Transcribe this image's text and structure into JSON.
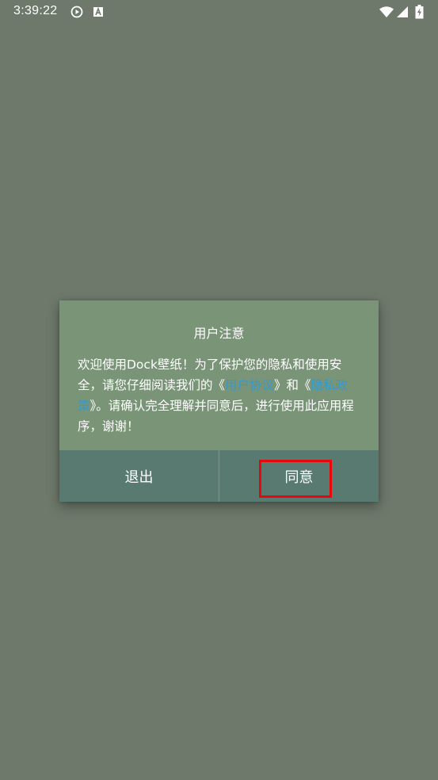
{
  "status_bar": {
    "time": "3:39:22",
    "icons": [
      "play-circle-icon",
      "a-box-icon",
      "wifi-icon",
      "signal-icon",
      "battery-charging-icon"
    ]
  },
  "dialog": {
    "title": "用户注意",
    "body": {
      "part1": "欢迎使用Dock壁纸！为了保护您的隐私和使用安全，请您仔细阅读我们的《",
      "link1": "用户协议",
      "part2": "》和《",
      "link2": "隐私政策",
      "part3": "》。请确认完全理解并同意后，进行使用此应用程序，谢谢！"
    },
    "buttons": {
      "exit_label": "退出",
      "agree_label": "同意"
    }
  },
  "colors": {
    "background": "#6e796b",
    "dialog_background": "#7a9477",
    "button_bar": "#597a70",
    "link": "#2f9bd6",
    "highlight": "#e8070b"
  }
}
